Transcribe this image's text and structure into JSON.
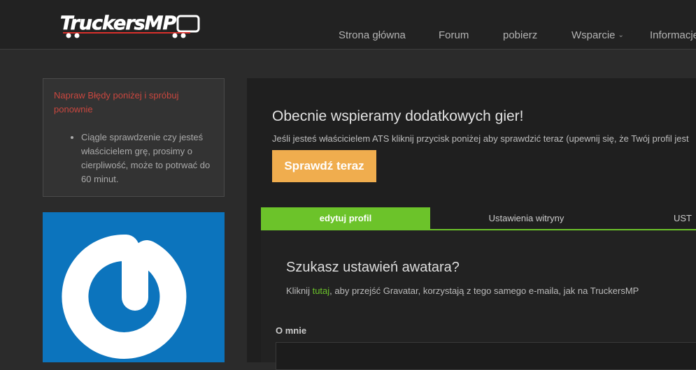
{
  "header": {
    "logo_text": "TruckersMP",
    "nav": [
      {
        "label": "Strona główna"
      },
      {
        "label": "Forum"
      },
      {
        "label": "pobierz"
      },
      {
        "label": "Wsparcie",
        "has_dropdown": true
      },
      {
        "label": "Informacje"
      }
    ]
  },
  "sidebar": {
    "error_title": "Napraw Błędy poniżej i spróbuj ponownie",
    "error_items": [
      "Ciągle sprawdzenie czy jesteś właścicielem grę, prosimy o cierpliwość, może to potrwać do 60 minut."
    ],
    "avatar_icon": "gravatar-icon"
  },
  "main": {
    "heading": "Obecnie wspieramy dodatkowych gier!",
    "subtext": "Jeśli jesteś właścicielem ATS kliknij przycisk poniżej aby sprawdzić teraz (upewnij się, że Twój profil jest",
    "check_button": "Sprawdź teraz",
    "tabs": [
      {
        "label": "edytuj profil",
        "active": true
      },
      {
        "label": "Ustawienia witryny",
        "active": false
      },
      {
        "label": "UST",
        "active": false
      }
    ],
    "panel": {
      "title": "Szukasz ustawień awatara?",
      "text_before": "Kliknij ",
      "link": "tutaj",
      "text_after": ", aby przejść Gravatar, korzystają z tego samego e-maila, jak na TruckersMP",
      "about_label": "O mnie"
    }
  },
  "colors": {
    "accent_green": "#6cc32a",
    "button_orange": "#f0ad4e",
    "error_red": "#c9473f",
    "gravatar_blue": "#0c74bd"
  }
}
